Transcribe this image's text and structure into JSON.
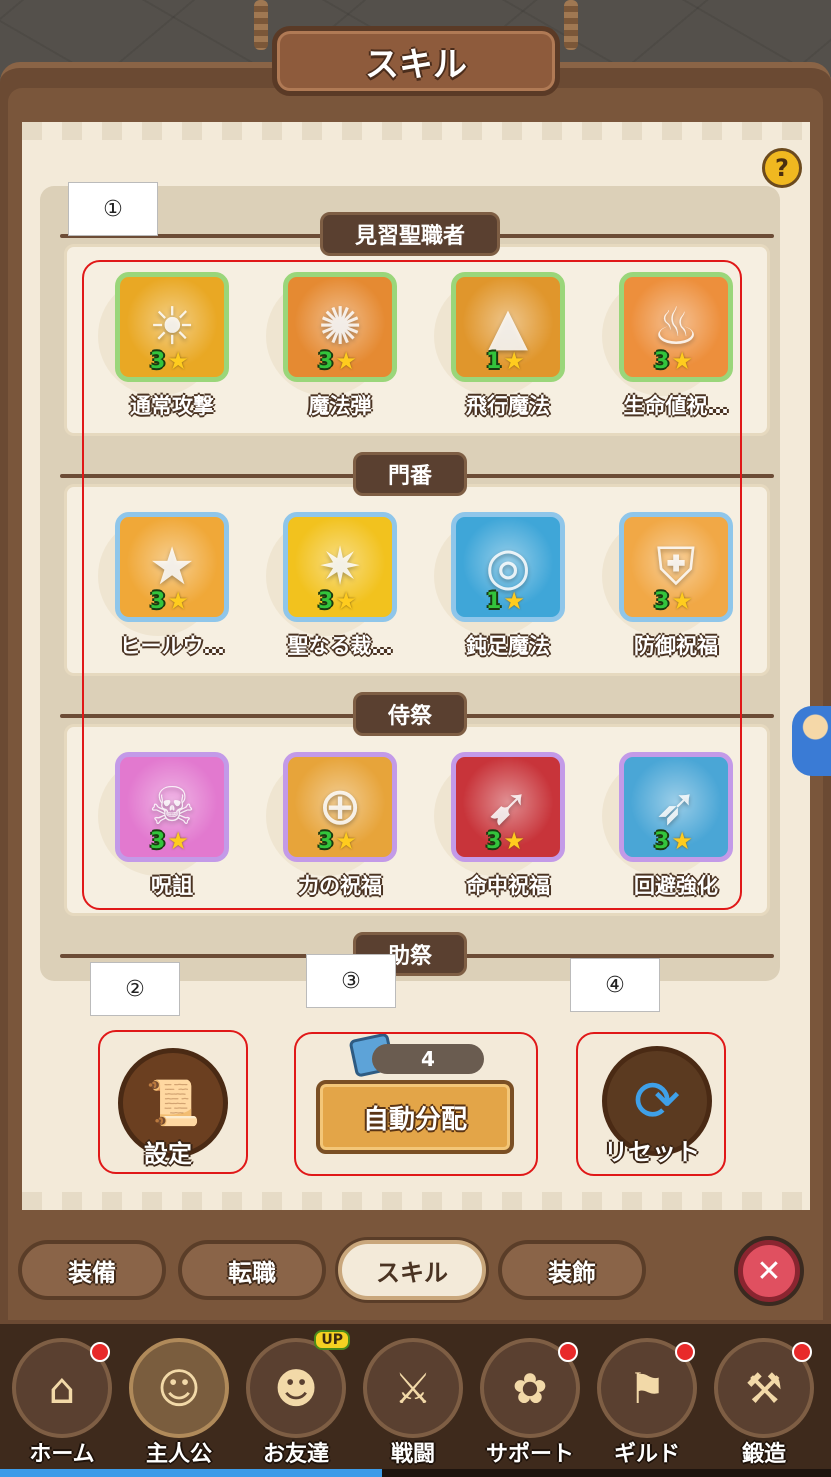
{
  "window": {
    "title": "スキル"
  },
  "help_icon": "question-icon",
  "sections": [
    {
      "label": "見習聖職者",
      "skills": [
        {
          "name": "通常攻撃",
          "level": "3",
          "frame": "green",
          "icon": "sun-icon",
          "color": "#e9a824"
        },
        {
          "name": "魔法弾",
          "level": "3",
          "frame": "green",
          "icon": "fireball-icon",
          "color": "#e58a32"
        },
        {
          "name": "飛行魔法",
          "level": "1",
          "frame": "green",
          "icon": "triangle-rune-icon",
          "color": "#e0962c"
        },
        {
          "name": "生命値祝…",
          "level": "3",
          "frame": "green",
          "icon": "flame-heart-icon",
          "color": "#ed8f3c"
        }
      ]
    },
    {
      "label": "門番",
      "skills": [
        {
          "name": "ヒールウ…",
          "level": "3",
          "frame": "blue",
          "icon": "star-wand-icon",
          "color": "#f0a838"
        },
        {
          "name": "聖なる裁…",
          "level": "3",
          "frame": "blue",
          "icon": "holy-light-icon",
          "color": "#f2c21e"
        },
        {
          "name": "鈍足魔法",
          "level": "1",
          "frame": "blue",
          "icon": "swirl-icon",
          "color": "#3fa6d8"
        },
        {
          "name": "防御祝福",
          "level": "3",
          "frame": "blue",
          "icon": "shield-icon",
          "color": "#f1a846"
        }
      ]
    },
    {
      "label": "侍祭",
      "skills": [
        {
          "name": "呪詛",
          "level": "3",
          "frame": "purple",
          "icon": "curse-icon",
          "color": "#e279cf"
        },
        {
          "name": "力の祝福",
          "level": "3",
          "frame": "purple",
          "icon": "target-icon",
          "color": "#e7a43a"
        },
        {
          "name": "命中祝福",
          "level": "3",
          "frame": "purple",
          "icon": "arrow-hit-icon",
          "color": "#c8343a"
        },
        {
          "name": "回避強化",
          "level": "3",
          "frame": "purple",
          "icon": "winged-boot-icon",
          "color": "#4aa6d6"
        }
      ]
    },
    {
      "label": "助祭",
      "skills": []
    }
  ],
  "annotations": [
    "①",
    "②",
    "③",
    "④"
  ],
  "actions": {
    "settings_label": "設定",
    "auto_points": "4",
    "auto_label": "自動分配",
    "reset_label": "リセット"
  },
  "tabs": [
    {
      "label": "装備",
      "active": false
    },
    {
      "label": "転職",
      "active": false
    },
    {
      "label": "スキル",
      "active": true
    },
    {
      "label": "装飾",
      "active": false
    }
  ],
  "close_icon": "close-icon",
  "bottom_nav": [
    {
      "label": "ホーム",
      "icon": "home-icon",
      "notification": true
    },
    {
      "label": "主人公",
      "icon": "hero-icon",
      "notification": false,
      "featured": true
    },
    {
      "label": "お友達",
      "icon": "friend-icon",
      "notification": false,
      "badge": "UP"
    },
    {
      "label": "戦闘",
      "icon": "crossed-swords-icon",
      "notification": false
    },
    {
      "label": "サポート",
      "icon": "support-icon",
      "notification": true
    },
    {
      "label": "ギルド",
      "icon": "guild-icon",
      "notification": true
    },
    {
      "label": "鍛造",
      "icon": "anvil-icon",
      "notification": true
    }
  ],
  "progress": {
    "fraction": 0.46
  },
  "colors": {
    "annotation_red": "#e01818",
    "star": "#ffcc1e",
    "level_green": "#33c43c"
  }
}
